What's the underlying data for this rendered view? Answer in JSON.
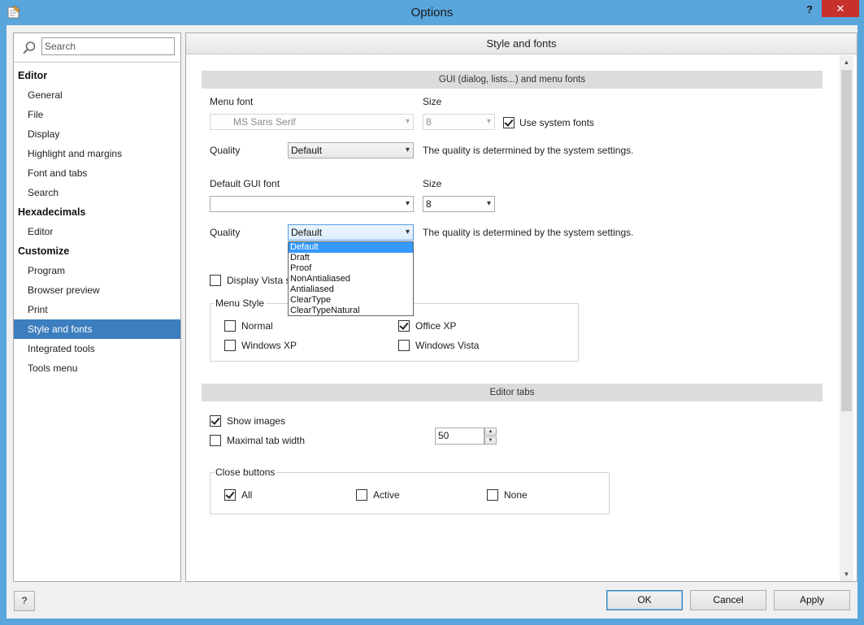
{
  "window": {
    "title": "Options",
    "help_glyph": "?",
    "close_glyph": "✕",
    "accent": "#59a6dc",
    "close_color": "#c7312b"
  },
  "nav": {
    "search_placeholder": "Search",
    "groups": [
      {
        "header": "Editor",
        "items": [
          "General",
          "File",
          "Display",
          "Highlight and margins",
          "Font and tabs",
          "Search"
        ]
      },
      {
        "header": "Hexadecimals",
        "items": [
          "Editor"
        ]
      },
      {
        "header": "Customize",
        "items": [
          "Program",
          "Browser preview",
          "Print",
          "Style and fonts",
          "Integrated tools",
          "Tools menu"
        ]
      }
    ],
    "selected": "Style and fonts",
    "selected_color": "#3d7ebe"
  },
  "panel": {
    "title": "Style and fonts",
    "gui_section": {
      "title": "GUI (dialog, lists...) and menu fonts",
      "menu_font_label": "Menu font",
      "menu_font_value": "MS Sans Serif",
      "size_label": "Size",
      "menu_size_value": "8",
      "use_system_fonts_label": "Use system fonts",
      "use_system_fonts_checked": true,
      "quality_label": "Quality",
      "quality1_value": "Default",
      "quality1_note": "The quality is determined by the system settings.",
      "default_gui_font_label": "Default GUI font",
      "default_gui_font_value": "",
      "size2_label": "Size",
      "gui_size_value": "8",
      "quality2_label": "Quality",
      "quality2_value": "Default",
      "quality2_note": "The quality is determined by the system settings.",
      "quality_options": [
        "Default",
        "Draft",
        "Proof",
        "NonAntialiased",
        "Antialiased",
        "ClearType",
        "ClearTypeNatural"
      ],
      "quality_selected": "Default",
      "display_vista_label": "Display Vista sty",
      "display_vista_checked": false
    },
    "menu_style": {
      "title": "Menu Style",
      "options": [
        {
          "label": "Normal",
          "checked": false
        },
        {
          "label": "Office XP",
          "checked": true
        },
        {
          "label": "Windows XP",
          "checked": false
        },
        {
          "label": "Windows Vista",
          "checked": false
        }
      ]
    },
    "editor_tabs": {
      "title": "Editor tabs",
      "show_images_label": "Show images",
      "show_images_checked": true,
      "max_tab_width_label": "Maximal tab width",
      "max_tab_width_checked": false,
      "max_tab_width_value": "50"
    },
    "close_buttons": {
      "title": "Close buttons",
      "options": [
        {
          "label": "All",
          "checked": true
        },
        {
          "label": "Active",
          "checked": false
        },
        {
          "label": "None",
          "checked": false
        }
      ]
    }
  },
  "footer": {
    "help_label": "?",
    "ok_label": "OK",
    "cancel_label": "Cancel",
    "apply_label": "Apply"
  }
}
